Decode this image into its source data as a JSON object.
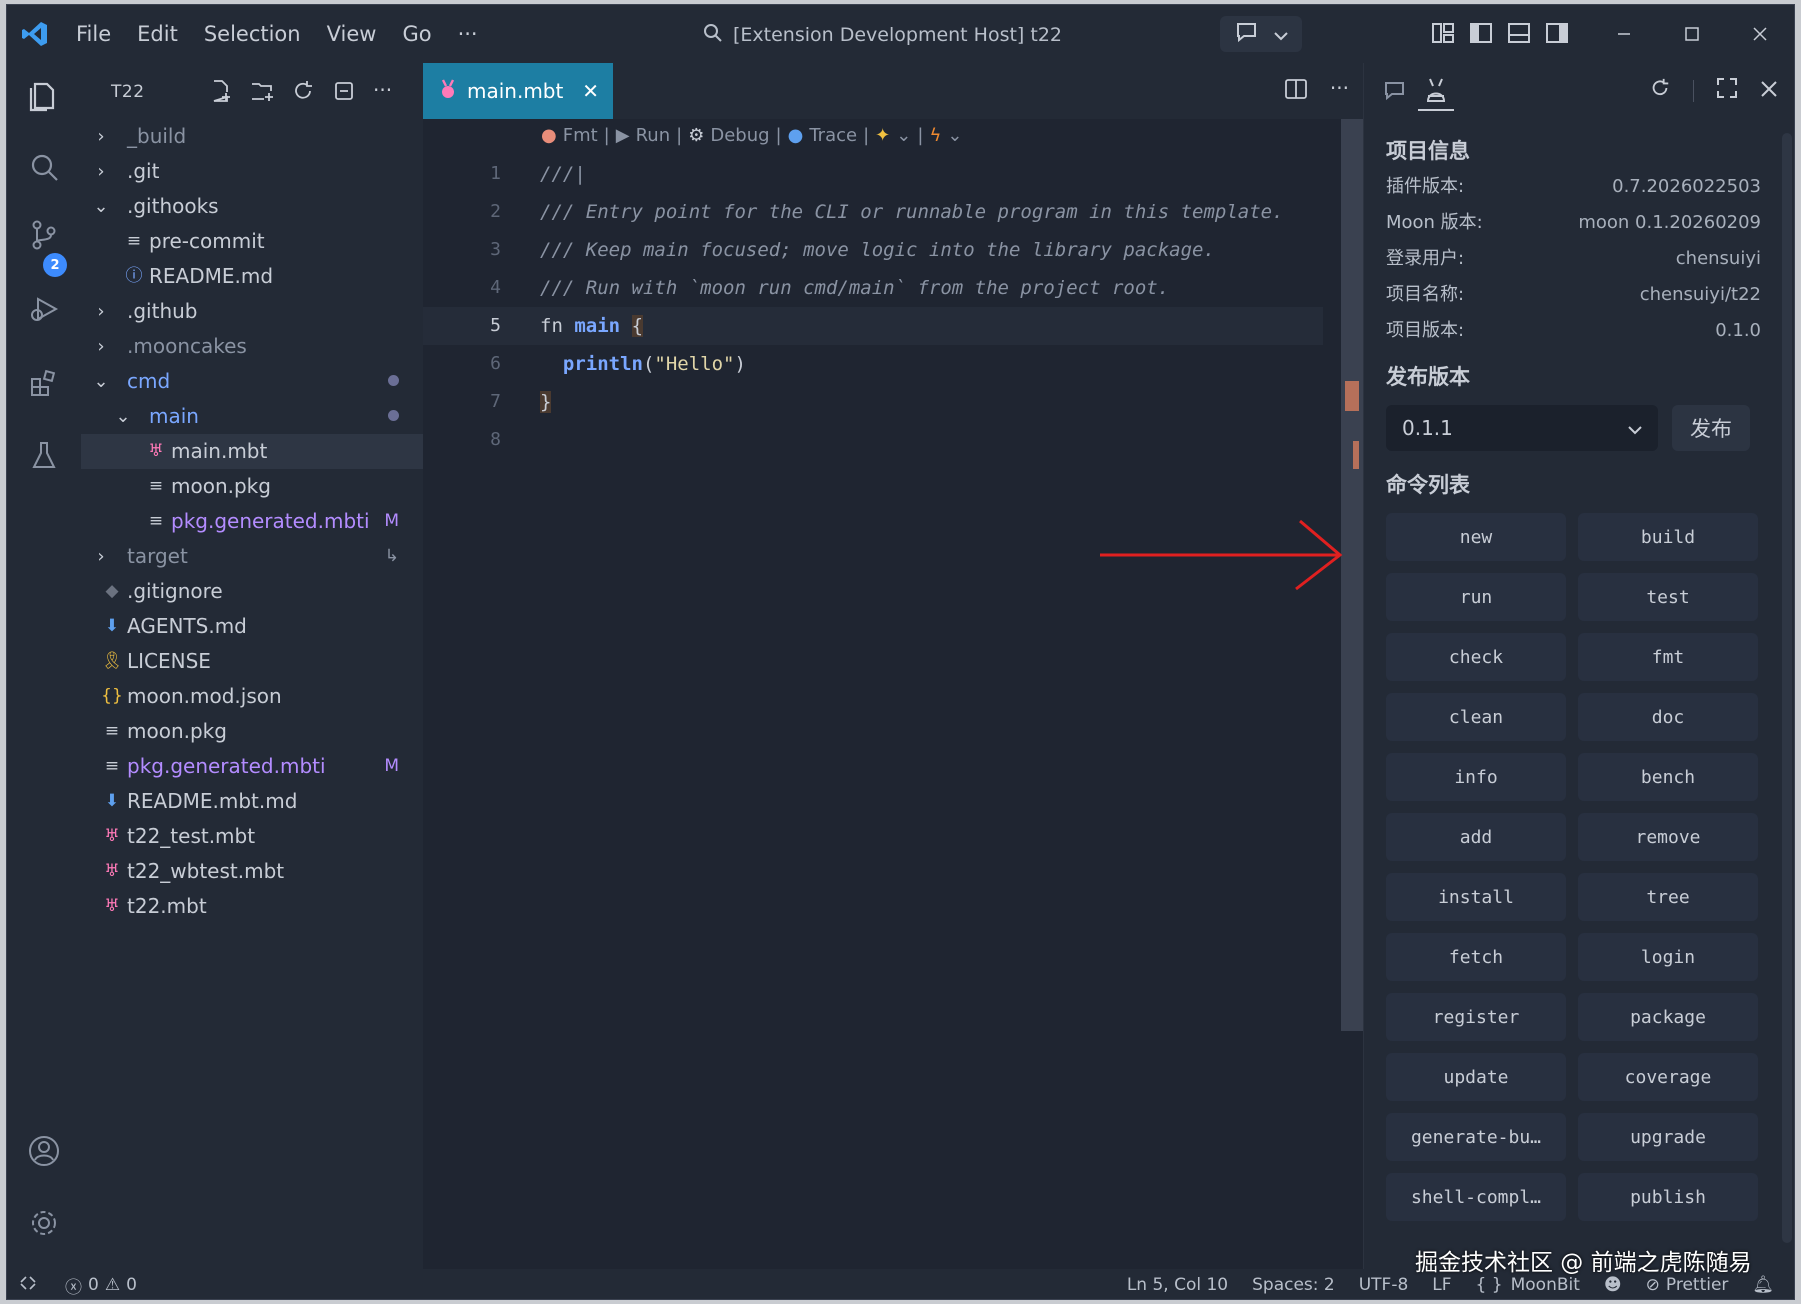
{
  "menu": [
    "File",
    "Edit",
    "Selection",
    "View",
    "Go",
    "···"
  ],
  "title": "[Extension Development Host] t22",
  "sidebar": {
    "title": "T22",
    "tree": [
      {
        "label": "_build",
        "type": "folder",
        "expanded": false,
        "depth": 0
      },
      {
        "label": ".git",
        "type": "folder",
        "expanded": false,
        "depth": 0
      },
      {
        "label": ".githooks",
        "type": "folder",
        "expanded": true,
        "depth": 0
      },
      {
        "label": "pre-commit",
        "type": "file",
        "icon": "lines-icon",
        "depth": 1
      },
      {
        "label": "README.md",
        "type": "file",
        "icon": "info-icon",
        "depth": 1
      },
      {
        "label": ".github",
        "type": "folder",
        "expanded": false,
        "depth": 0
      },
      {
        "label": ".mooncakes",
        "type": "folder",
        "expanded": false,
        "depth": 0
      },
      {
        "label": "cmd",
        "type": "folder",
        "expanded": true,
        "depth": 0,
        "deco": "dot"
      },
      {
        "label": "main",
        "type": "folder",
        "expanded": true,
        "depth": 1,
        "deco": "dot"
      },
      {
        "label": "main.mbt",
        "type": "file",
        "icon": "moonbit-icon",
        "depth": 2,
        "selected": true
      },
      {
        "label": "moon.pkg",
        "type": "file",
        "icon": "lines-icon",
        "depth": 2
      },
      {
        "label": "pkg.generated.mbti",
        "type": "file",
        "icon": "lines-icon",
        "depth": 2,
        "deco": "M"
      },
      {
        "label": "target",
        "type": "folder",
        "expanded": false,
        "depth": 0,
        "deco": "↳"
      },
      {
        "label": ".gitignore",
        "type": "file",
        "icon": "git-icon",
        "depth": 0
      },
      {
        "label": "AGENTS.md",
        "type": "file",
        "icon": "markdown-icon",
        "depth": 0
      },
      {
        "label": "LICENSE",
        "type": "file",
        "icon": "license-icon",
        "depth": 0
      },
      {
        "label": "moon.mod.json",
        "type": "file",
        "icon": "json-icon",
        "depth": 0
      },
      {
        "label": "moon.pkg",
        "type": "file",
        "icon": "lines-icon",
        "depth": 0
      },
      {
        "label": "pkg.generated.mbti",
        "type": "file",
        "icon": "lines-icon",
        "depth": 0,
        "deco": "M"
      },
      {
        "label": "README.mbt.md",
        "type": "file",
        "icon": "markdown-icon",
        "depth": 0
      },
      {
        "label": "t22_test.mbt",
        "type": "file",
        "icon": "moonbit-icon",
        "depth": 0
      },
      {
        "label": "t22_wbtest.mbt",
        "type": "file",
        "icon": "moonbit-icon",
        "depth": 0
      },
      {
        "label": "t22.mbt",
        "type": "file",
        "icon": "moonbit-icon",
        "depth": 0
      }
    ]
  },
  "editor": {
    "tab": "main.mbt",
    "codelens": [
      "Fmt",
      "Run",
      "Debug",
      "Trace"
    ],
    "lines": [
      {
        "n": "1",
        "html": "<span class='cmt'>///|</span>"
      },
      {
        "n": "2",
        "html": "<span class='cmt'>/// Entry point for the CLI or runnable program in this template.</span>"
      },
      {
        "n": "3",
        "html": "<span class='cmt'>/// Keep main focused; move logic into the library package.</span>"
      },
      {
        "n": "4",
        "html": "<span class='cmt'>/// Run with `moon run cmd/main` from the project root.</span>"
      },
      {
        "n": "5",
        "html": "<span class='kw'>fn</span> <span class='fn'>main</span> <span class='brace'>{</span>",
        "current": true
      },
      {
        "n": "6",
        "html": "  <span class='fn'>println</span>(<span class='str'>\"Hello\"</span>)"
      },
      {
        "n": "7",
        "html": "<span class='brace'>}</span>"
      },
      {
        "n": "8",
        "html": ""
      }
    ]
  },
  "panel": {
    "project_title": "项目信息",
    "info": [
      {
        "k": "插件版本:",
        "v": "0.7.2026022503"
      },
      {
        "k": "Moon 版本:",
        "v": "moon 0.1.20260209"
      },
      {
        "k": "登录用户:",
        "v": "chensuiyi"
      },
      {
        "k": "项目名称:",
        "v": "chensuiyi/t22"
      },
      {
        "k": "项目版本:",
        "v": "0.1.0"
      }
    ],
    "release_title": "发布版本",
    "release_version": "0.1.1",
    "publish_label": "发布",
    "commands_title": "命令列表",
    "commands": [
      "new",
      "build",
      "run",
      "test",
      "check",
      "fmt",
      "clean",
      "doc",
      "info",
      "bench",
      "add",
      "remove",
      "install",
      "tree",
      "fetch",
      "login",
      "register",
      "package",
      "update",
      "coverage",
      "generate-bu…",
      "upgrade",
      "shell-compl…",
      "publish"
    ]
  },
  "statusbar": {
    "errors": "0",
    "warnings": "0",
    "position": "Ln 5, Col 10",
    "spaces": "Spaces: 2",
    "encoding": "UTF-8",
    "eol": "LF",
    "language": "MoonBit",
    "formatter": "Prettier"
  },
  "watermark": "掘金技术社区 @ 前端之虎陈随易"
}
